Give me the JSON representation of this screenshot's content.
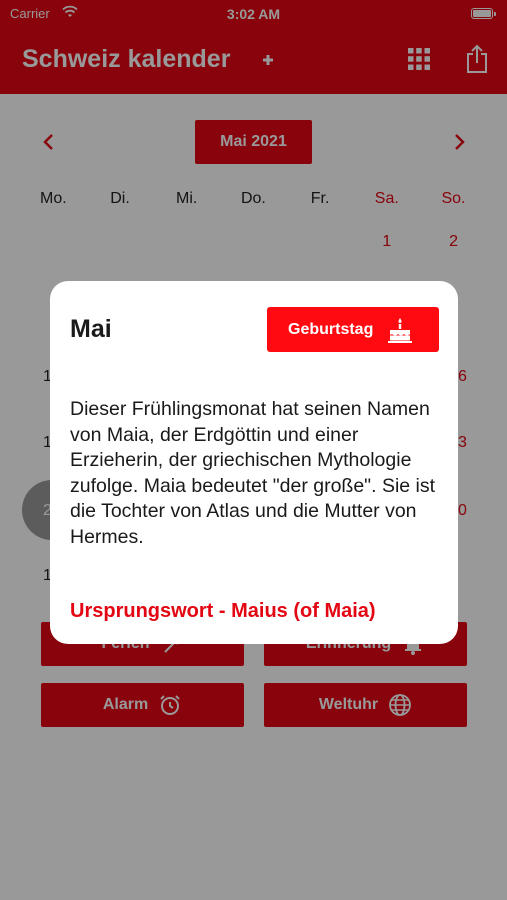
{
  "status_bar": {
    "carrier": "Carrier",
    "time": "3:02 AM"
  },
  "nav": {
    "title": "Schweiz kalender",
    "grid_icon": "grid-icon",
    "share_icon": "share-icon"
  },
  "calendar": {
    "month_label": "Mai 2021",
    "weekdays": [
      "Mo.",
      "Di.",
      "Mi.",
      "Do.",
      "Fr.",
      "Sa.",
      "So."
    ],
    "first_week": [
      "1",
      "2"
    ],
    "partially_visible_days": [
      "1",
      "6",
      "1",
      "3",
      "2",
      "0",
      "1"
    ]
  },
  "actions": {
    "ferien": "Ferien",
    "erinnerung": "Erinnerung",
    "alarm": "Alarm",
    "weltuhr": "Weltuhr"
  },
  "dialog": {
    "title": "Mai",
    "birthday_button": "Geburtstag",
    "body": "Dieser Frühlingsmonat hat seinen Namen von Maia, der Erdgöttin und einer Erzieherin, der griechischen Mythologie zufolge. Maia bedeutet \"der große\". Sie ist die Tochter von Atlas und die Mutter von Hermes.",
    "origin": "Ursprungswort - Maius (of Maia)"
  },
  "colors": {
    "accent": "#e30613",
    "dialog_button": "#ff0a10",
    "text": "#1a1a1a"
  }
}
